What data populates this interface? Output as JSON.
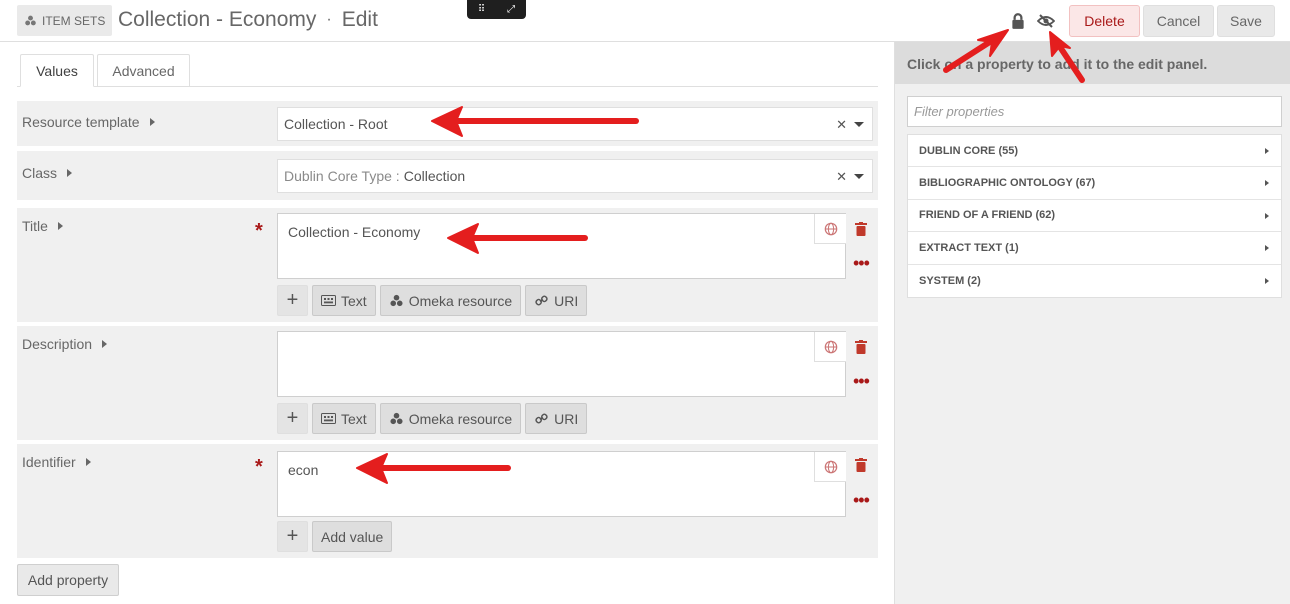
{
  "header": {
    "crumb_label": "ITEM SETS",
    "title_main": "Collection - Economy",
    "title_sep": "·",
    "title_mode": "Edit",
    "delete_label": "Delete",
    "cancel_label": "Cancel",
    "save_label": "Save"
  },
  "tabs": [
    {
      "label": "Values"
    },
    {
      "label": "Advanced"
    }
  ],
  "fields": {
    "resource_template": {
      "label": "Resource template",
      "value": "Collection - Root"
    },
    "class": {
      "label": "Class",
      "prefix": "Dublin Core Type :",
      "value": "Collection"
    },
    "title": {
      "label": "Title",
      "value": "Collection - Economy",
      "required_mark": "*"
    },
    "description": {
      "label": "Description",
      "value": ""
    },
    "identifier": {
      "label": "Identifier",
      "value": "econ",
      "required_mark": "*"
    }
  },
  "value_buttons": {
    "text": "Text",
    "omeka": "Omeka resource",
    "uri": "URI",
    "add_value": "Add value",
    "plus": "+"
  },
  "add_property_label": "Add property",
  "sidebar": {
    "heading": "Click on a property to add it to the edit panel.",
    "filter_placeholder": "Filter properties",
    "vocabularies": [
      {
        "label": "DUBLIN CORE (55)"
      },
      {
        "label": "BIBLIOGRAPHIC ONTOLOGY (67)"
      },
      {
        "label": "FRIEND OF A FRIEND (62)"
      },
      {
        "label": "EXTRACT TEXT (1)"
      },
      {
        "label": "SYSTEM (2)"
      }
    ]
  },
  "colors": {
    "delete": "#a91919",
    "annotation_arrow": "#e41e1e"
  }
}
